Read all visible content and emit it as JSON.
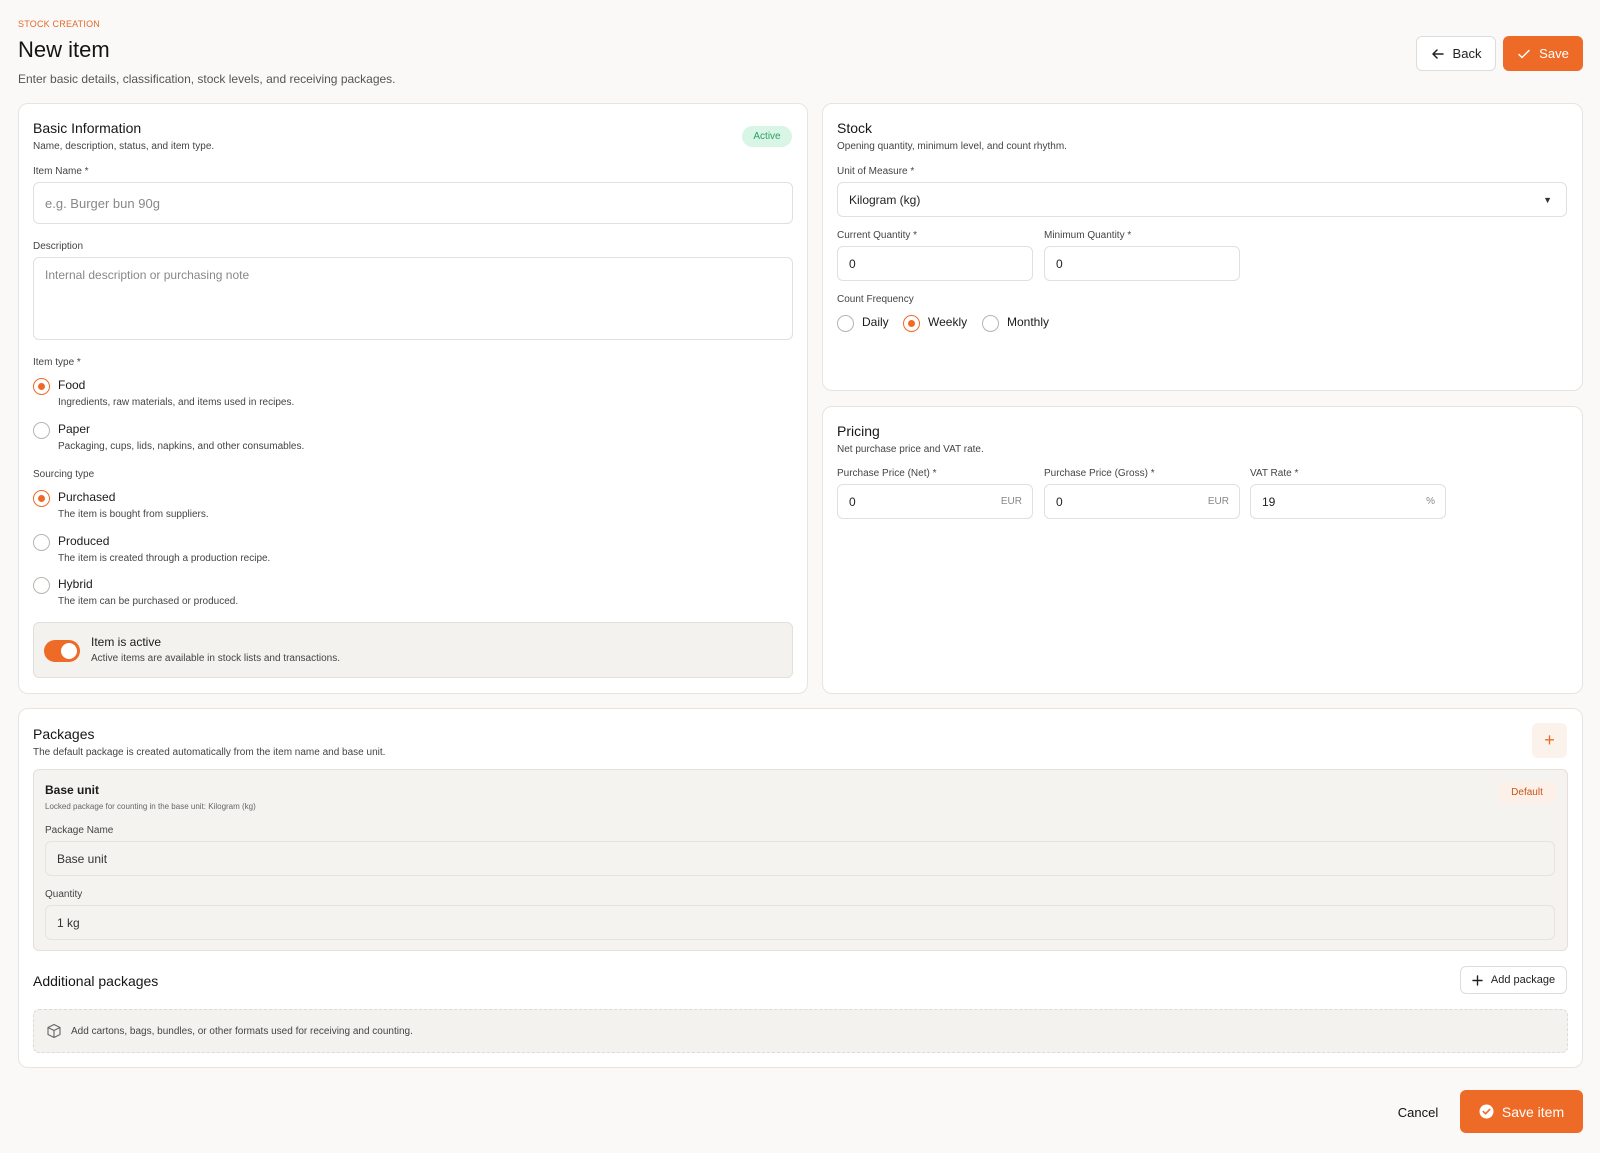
{
  "header": {
    "eyebrow": "STOCK CREATION",
    "title": "New item",
    "subtitle": "Enter basic details, classification, stock levels, and receiving packages.",
    "back_label": "Back",
    "save_label": "Save"
  },
  "basic": {
    "title": "Basic Information",
    "subtitle": "Name, description, status, and item type.",
    "status_badge": "Active",
    "item_name_label": "Item Name *",
    "item_name_placeholder": "e.g. Burger bun 90g",
    "description_label": "Description",
    "description_placeholder": "Internal description or purchasing note",
    "item_type_label": "Item type *",
    "item_types": [
      {
        "title": "Food",
        "desc": "Ingredients, raw materials, and items used in recipes.",
        "selected": true
      },
      {
        "title": "Paper",
        "desc": "Packaging, cups, lids, napkins, and other consumables.",
        "selected": false
      }
    ],
    "sourcing_label": "Sourcing type",
    "sourcing_types": [
      {
        "title": "Purchased",
        "desc": "The item is bought from suppliers.",
        "selected": true
      },
      {
        "title": "Produced",
        "desc": "The item is created through a production recipe.",
        "selected": false
      },
      {
        "title": "Hybrid",
        "desc": "The item can be purchased or produced.",
        "selected": false
      }
    ],
    "active_toggle": {
      "title": "Item is active",
      "desc": "Active items are available in stock lists and transactions.",
      "on": true
    }
  },
  "stock": {
    "title": "Stock",
    "subtitle": "Opening quantity, minimum level, and count rhythm.",
    "uom_label": "Unit of Measure *",
    "uom_value": "Kilogram (kg)",
    "current_qty_label": "Current Quantity *",
    "current_qty_value": "0",
    "min_qty_label": "Minimum Quantity *",
    "min_qty_value": "0",
    "count_freq_label": "Count Frequency",
    "count_freq_options": [
      {
        "label": "Daily",
        "selected": false
      },
      {
        "label": "Weekly",
        "selected": true
      },
      {
        "label": "Monthly",
        "selected": false
      }
    ]
  },
  "pricing": {
    "title": "Pricing",
    "subtitle": "Net purchase price and VAT rate.",
    "net_label": "Purchase Price (Net) *",
    "net_value": "0",
    "net_suffix": "EUR",
    "gross_label": "Purchase Price (Gross) *",
    "gross_value": "0",
    "gross_suffix": "EUR",
    "vat_label": "VAT Rate *",
    "vat_value": "19",
    "vat_suffix": "%"
  },
  "packages": {
    "title": "Packages",
    "subtitle": "The default package is created automatically from the item name and base unit.",
    "add_icon": "+",
    "base_unit": {
      "title": "Base unit",
      "desc": "Locked package for counting in the base unit: Kilogram (kg)",
      "badge": "Default",
      "name_label": "Package Name",
      "name_value": "Base unit",
      "qty_label": "Quantity",
      "qty_value": "1 kg"
    },
    "additional_title": "Additional packages",
    "add_package_label": "Add package",
    "empty_text": "Add cartons, bags, bundles, or other formats used for receiving and counting."
  },
  "footer": {
    "cancel_label": "Cancel",
    "save_item_label": "Save item"
  },
  "colors": {
    "accent": "#ee6b27",
    "success_bg": "#d9f5e6",
    "success_text": "#2e9e62"
  }
}
